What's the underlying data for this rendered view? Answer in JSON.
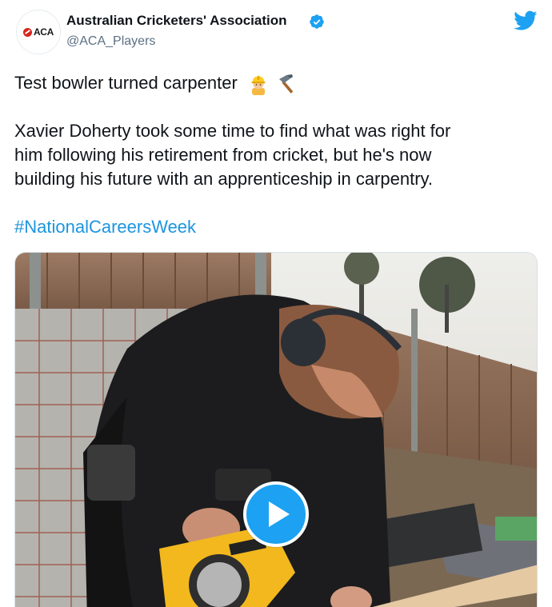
{
  "tweet": {
    "author": {
      "display_name": "Australian Cricketers' Association",
      "handle": "@ACA_Players",
      "avatar_text": "ACA",
      "verified": true
    },
    "lines": [
      "Test bowler turned carpenter",
      "Xavier Doherty took some time to find what was right for",
      "him following his retirement from cricket, but he's now",
      "building his future with an apprenticeship in carpentry."
    ],
    "emojis": [
      "construction-worker-emoji",
      "hammer-emoji"
    ],
    "hashtag": "#NationalCareersWeek",
    "media": {
      "type": "video",
      "description_icon": "play-icon"
    }
  },
  "colors": {
    "brand_blue": "#1da1f2",
    "hashtag_blue": "#1b95e0",
    "text": "#0f1419",
    "secondary_text": "#5b7083",
    "aca_red": "#d7261e"
  }
}
